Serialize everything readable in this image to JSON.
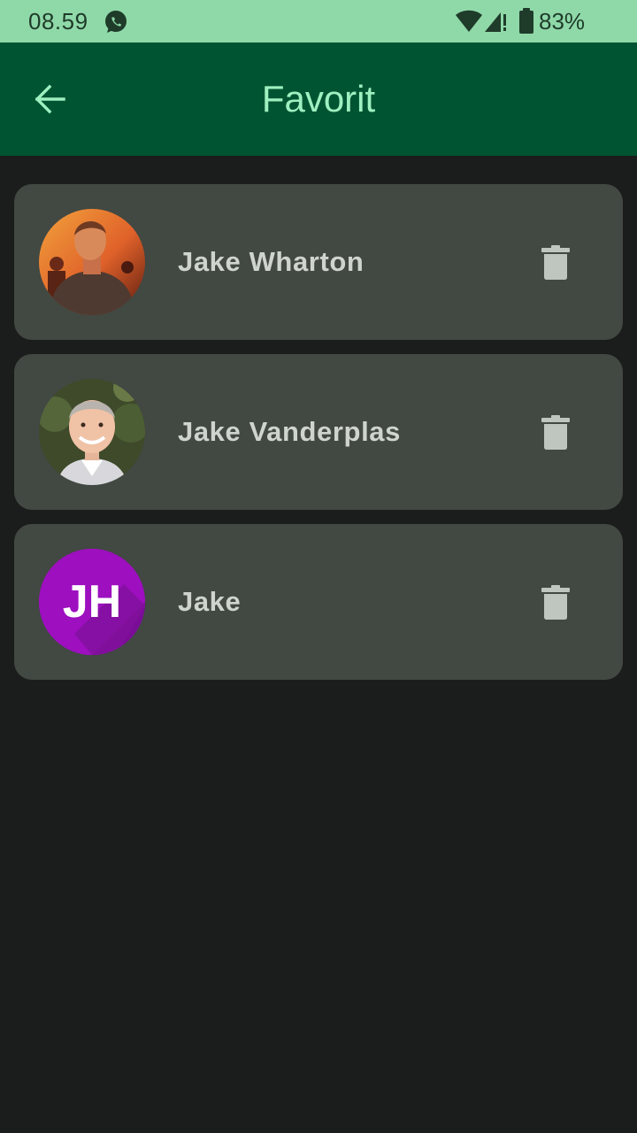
{
  "status_bar": {
    "time": "08.59",
    "battery": "83%",
    "icons": [
      "whatsapp-icon",
      "wifi-icon",
      "signal-icon",
      "battery-icon"
    ]
  },
  "app_bar": {
    "title": "Favorit",
    "back_icon": "arrow-left-icon"
  },
  "favorites": [
    {
      "name": "Jake Wharton",
      "avatar": "photo",
      "delete_icon": "trash-icon"
    },
    {
      "name": "Jake Vanderplas",
      "avatar": "photo",
      "delete_icon": "trash-icon"
    },
    {
      "name": "Jake",
      "avatar": "initials",
      "initials": "JH",
      "delete_icon": "trash-icon"
    }
  ],
  "colors": {
    "status_bar": "#8fd9a8",
    "app_bar": "#015432",
    "title": "#9ff0c0",
    "background": "#1b1c1c",
    "card": "#424842",
    "initials_avatar": "#9d0fbf"
  }
}
